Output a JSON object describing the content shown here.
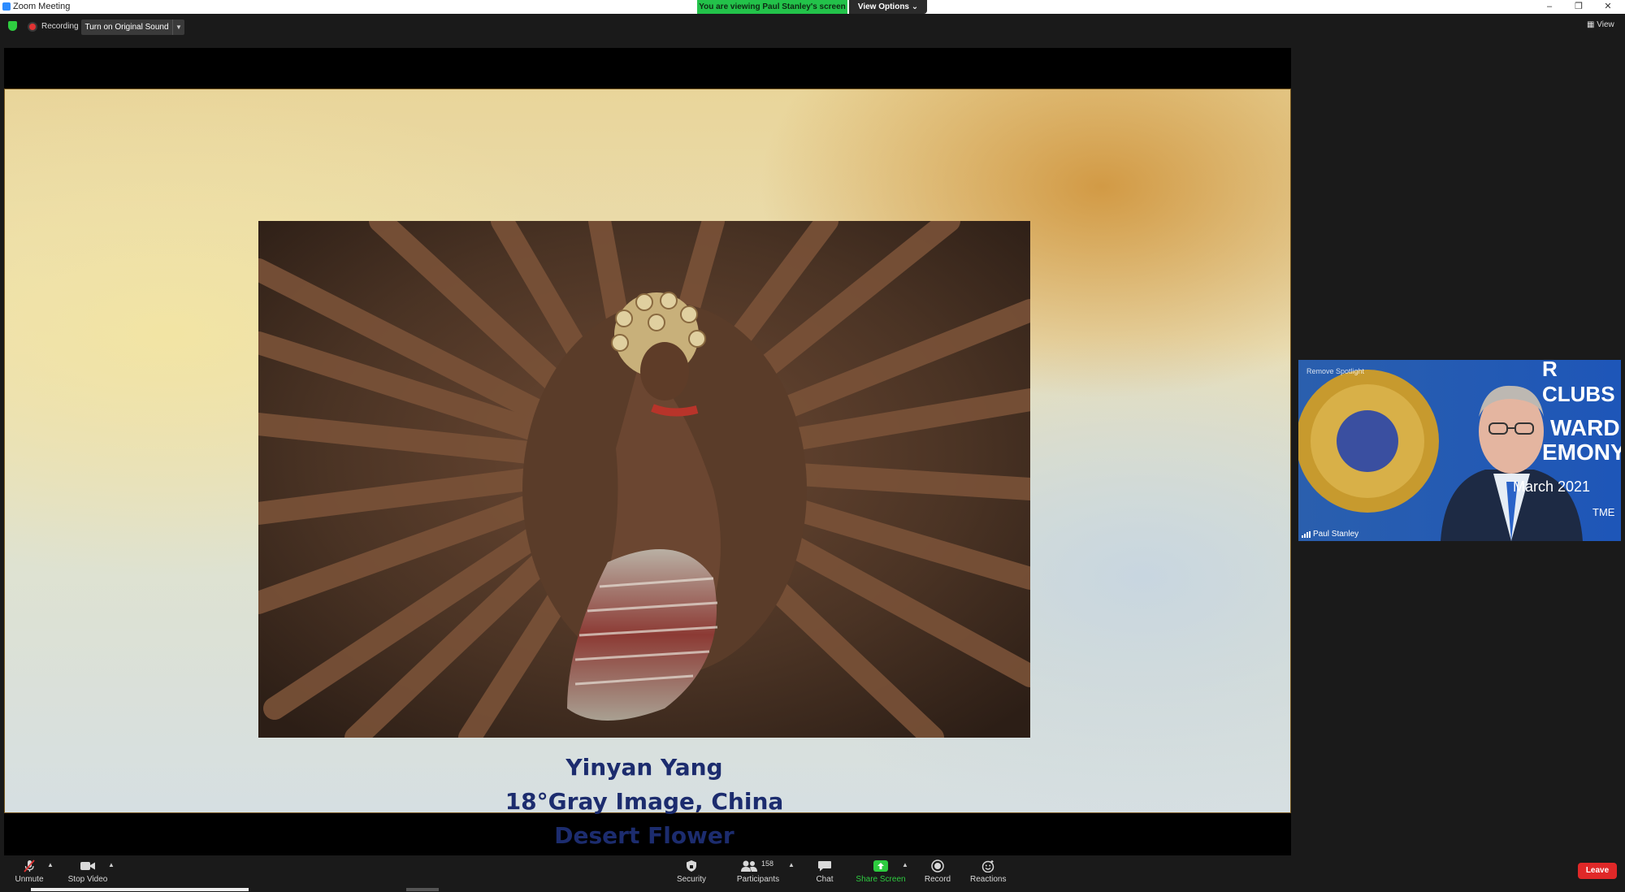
{
  "window": {
    "title": "Zoom Meeting",
    "viewing_notice": "You are viewing Paul Stanley's screen",
    "view_options": "View Options ⌄",
    "minimize": "–",
    "restore": "❐",
    "close": "✕"
  },
  "topbar": {
    "recording_label": "Recording",
    "original_sound_button": "Turn on Original Sound",
    "view_label": "View"
  },
  "slide": {
    "caption_line1": "Yinyan Yang",
    "caption_line2": "18°Gray Image, China",
    "caption_line3": "Desert Flower"
  },
  "speaker": {
    "name": "Paul Stanley",
    "spotlight_label": "Remove Spotlight",
    "background_text": [
      "R CLUBS",
      "WARD",
      "EMONY",
      "March 2021",
      "TME"
    ]
  },
  "toolbar": {
    "unmute": "Unmute",
    "stop_video": "Stop Video",
    "security": "Security",
    "participants": "Participants",
    "participants_count": "158",
    "chat": "Chat",
    "share_screen": "Share Screen",
    "record": "Record",
    "reactions": "Reactions",
    "leave": "Leave"
  },
  "colors": {
    "accent_green": "#23c24a",
    "leave_red": "#e02828",
    "share_green": "#2ecc40",
    "caption_navy": "#1c2c6e"
  }
}
